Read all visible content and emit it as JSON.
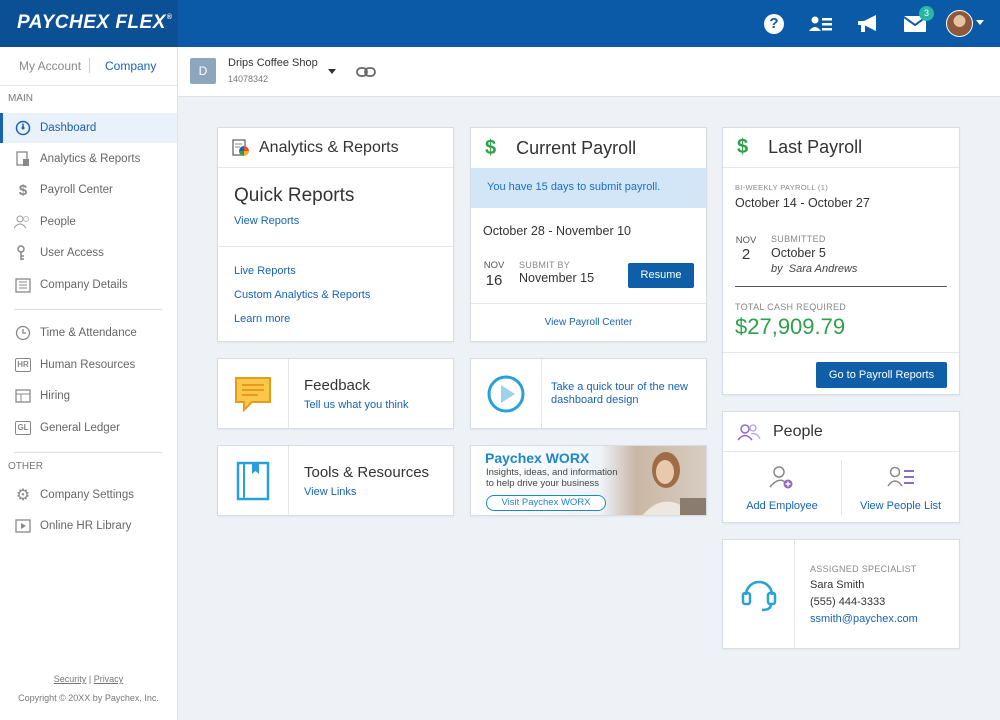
{
  "brand": {
    "name": "PAYCHEX FLEX",
    "mark": "®"
  },
  "topbar": {
    "mail_count": "3"
  },
  "colors": {
    "primary": "#0a5aa8",
    "green": "#2ea04a",
    "link": "#1763b3",
    "alert_bg": "#d3e6f8"
  },
  "sidebar": {
    "tabs": [
      "My Account",
      "Company"
    ],
    "section_main": "MAIN",
    "main_items": [
      {
        "label": "Dashboard",
        "icon": "dashboard-icon"
      },
      {
        "label": "Analytics & Reports",
        "icon": "report-icon"
      },
      {
        "label": "Payroll Center",
        "icon": "dollar-icon"
      },
      {
        "label": "People",
        "icon": "people-icon"
      },
      {
        "label": "User Access",
        "icon": "key-icon"
      },
      {
        "label": "Company Details",
        "icon": "building-icon"
      }
    ],
    "mid_items": [
      {
        "label": "Time & Attendance",
        "icon": "clock-icon"
      },
      {
        "label": "Human Resources",
        "icon": "hr-icon",
        "tag": "HR"
      },
      {
        "label": "Hiring",
        "icon": "hiring-icon"
      },
      {
        "label": "General Ledger",
        "icon": "gl-icon",
        "tag": "GL"
      }
    ],
    "section_other": "OTHER",
    "other_items": [
      {
        "label": "Company Settings",
        "icon": "gear-icon"
      },
      {
        "label": "Online HR Library",
        "icon": "video-icon"
      }
    ],
    "footer": {
      "security": "Security",
      "sep": "|",
      "privacy": "Privacy",
      "copyright": "Copyright © 20XX by  Paychex, Inc."
    }
  },
  "company": {
    "initial": "D",
    "name": "Drips Coffee Shop",
    "id": "14078342"
  },
  "analytics": {
    "title": "Analytics & Reports",
    "quick_title": "Quick Reports",
    "view_reports": "View Reports",
    "links": [
      "Live Reports",
      "Custom Analytics & Reports",
      "Learn more"
    ]
  },
  "current_payroll": {
    "title": "Current Payroll",
    "alert": "You have 15 days to submit payroll.",
    "period": "October 28 - November 10",
    "month": "NOV",
    "day": "16",
    "submit_label": "SUBMIT BY",
    "submit_date": "November 15",
    "resume": "Resume",
    "view_center": "View Payroll Center"
  },
  "last_payroll": {
    "title": "Last Payroll",
    "freq": "BI-WEEKLY PAYROLL (1)",
    "period": "October 14 - October 27",
    "month": "NOV",
    "day": "2",
    "submitted_label": "SUBMITTED",
    "submitted_date": "October 5",
    "by_prefix": "by",
    "by_name": "Sara Andrews",
    "cash_label": "TOTAL CASH REQUIRED",
    "cash": "$27,909.79",
    "go_reports": "Go to Payroll Reports"
  },
  "feedback": {
    "title": "Feedback",
    "link": "Tell us what you think"
  },
  "tour": {
    "text": "Take a quick tour of the new dashboard design"
  },
  "tools": {
    "title": "Tools & Resources",
    "link": "View Links"
  },
  "worx": {
    "title": "Paychex WORX",
    "line1": "Insights, ideas, and information",
    "line2": "to help drive your business",
    "cta": "Visit Paychex WORX"
  },
  "people": {
    "title": "People",
    "add": "Add Employee",
    "list": "View People List"
  },
  "specialist": {
    "label": "ASSIGNED SPECIALIST",
    "name": "Sara Smith",
    "phone": "(555) 444-3333",
    "email": "ssmith@paychex.com"
  }
}
